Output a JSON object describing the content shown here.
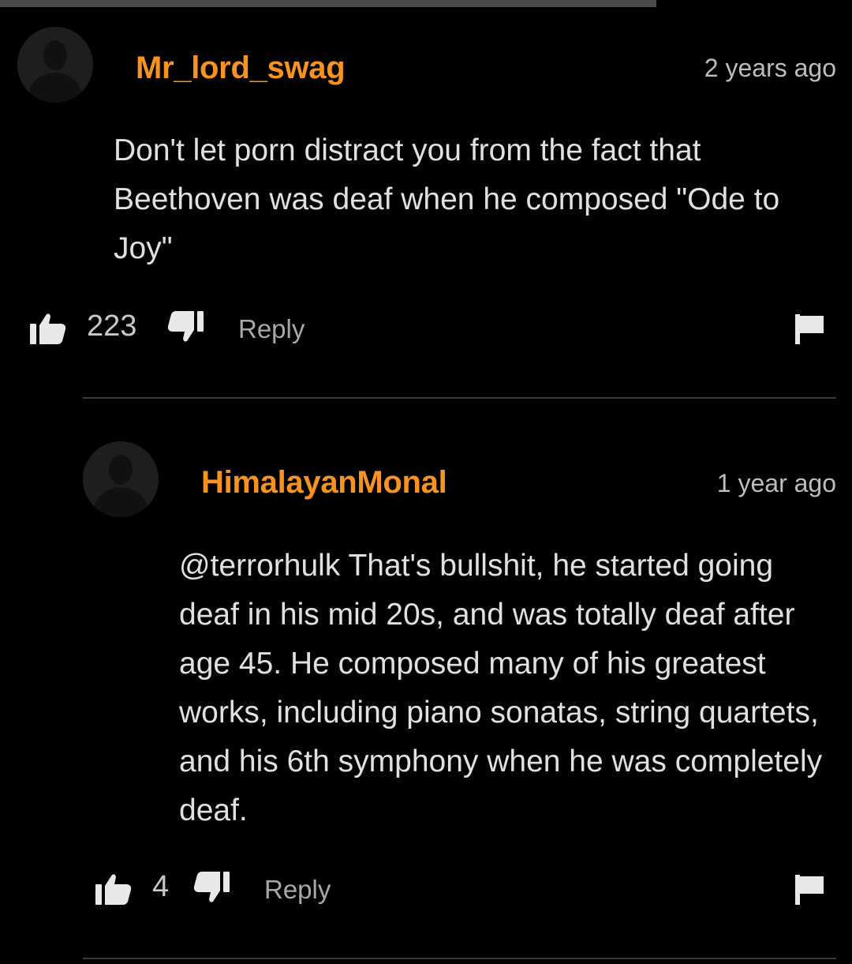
{
  "comments": [
    {
      "username": "Mr_lord_swag",
      "time": "2 years ago",
      "text": "Don't let porn distract you from the fact that Beethoven was deaf when he composed \"Ode to Joy\"",
      "likes": "223",
      "reply_label": "Reply",
      "avatar_icon": "user-silhouette-icon"
    },
    {
      "username": "HimalayanMonal",
      "time": "1 year ago",
      "text": "@terrorhulk That's bullshit, he started going deaf in his mid 20s, and was totally deaf after age 45. He composed many of his greatest works, including piano sonatas, string quartets, and his 6th symphony when he was completely deaf.",
      "likes": "4",
      "reply_label": "Reply",
      "avatar_icon": "user-silhouette-icon"
    }
  ],
  "colors": {
    "username": "#f7931e",
    "text": "#e0e0e0",
    "muted": "#a8a8a8",
    "background": "#000000",
    "icon": "#e8e8e8"
  }
}
